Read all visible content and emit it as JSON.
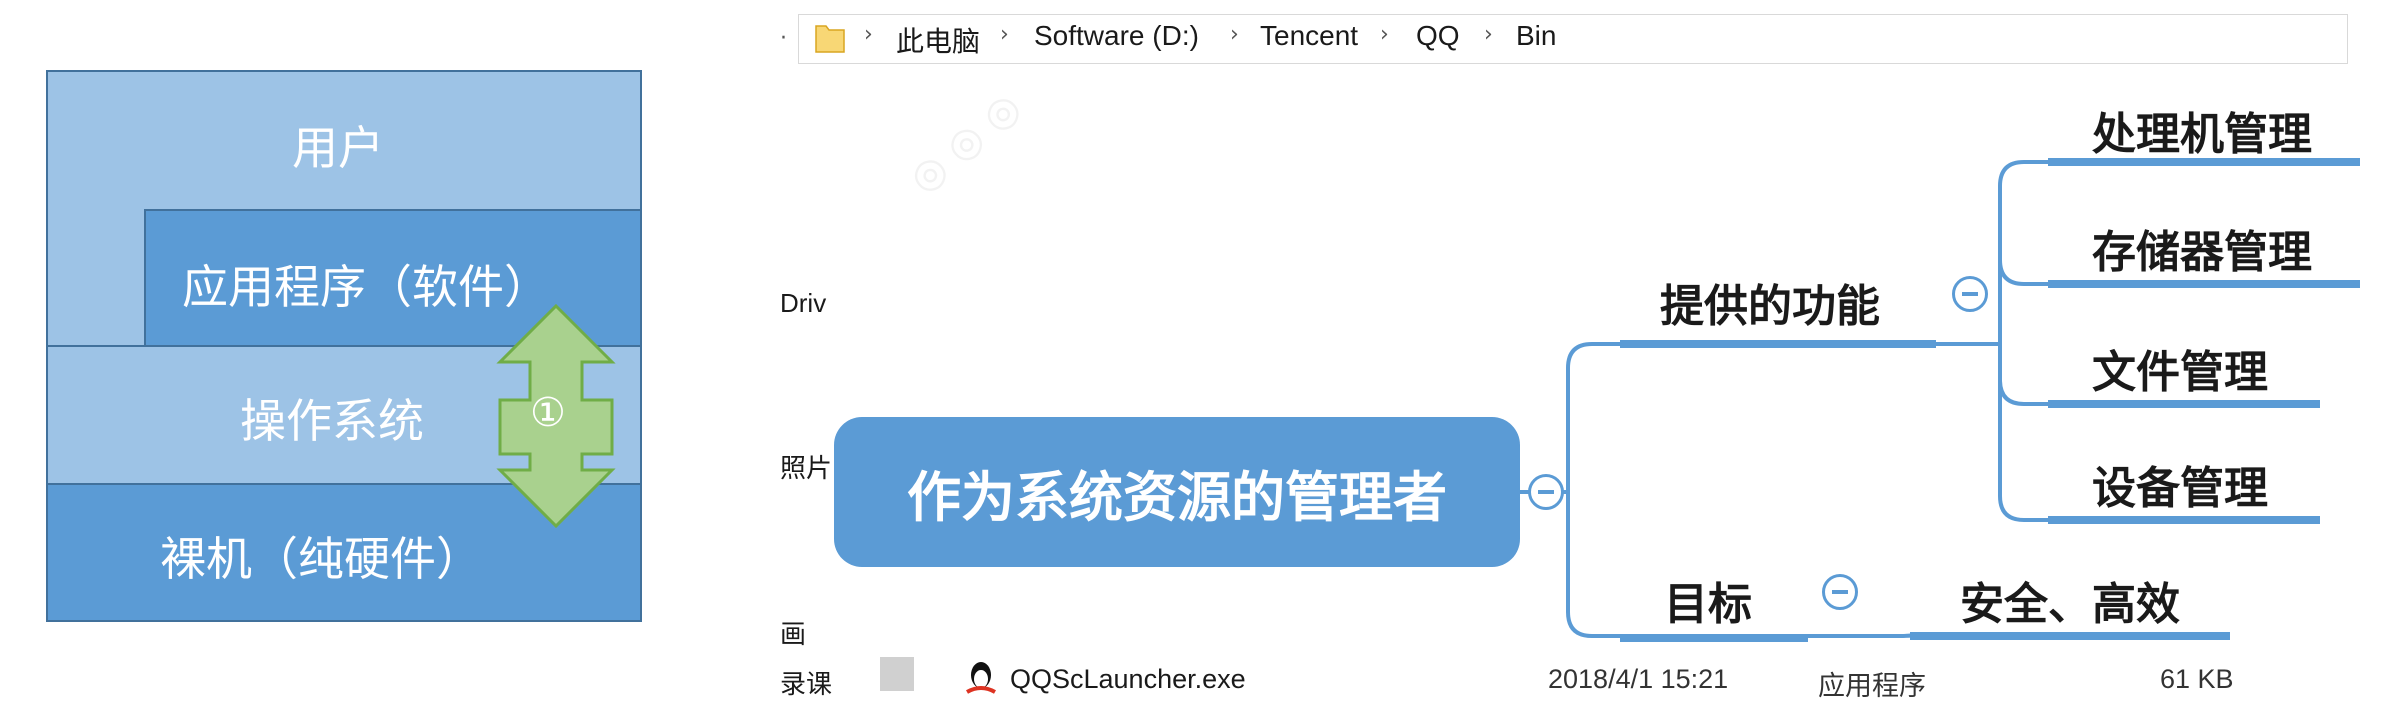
{
  "layers": {
    "user": "用户",
    "app": "应用程序（软件）",
    "os": "操作系统",
    "hardware": "裸机（纯硬件）",
    "marker": "①"
  },
  "explorer": {
    "breadcrumb": [
      "此电脑",
      "Software (D:)",
      "Tencent",
      "QQ",
      "Bin"
    ],
    "sidebar_fragments": [
      "Driv",
      "照片",
      "画",
      "录课"
    ],
    "file": {
      "name": "QQScLauncher.exe",
      "date": "2018/4/1 15:21",
      "type": "应用程序",
      "size": "61 KB"
    }
  },
  "mindmap": {
    "root": "作为系统资源的管理者",
    "branches": [
      {
        "label": "提供的功能",
        "children": [
          "处理机管理",
          "存储器管理",
          "文件管理",
          "设备管理"
        ]
      },
      {
        "label": "目标",
        "children": [
          "安全、高效"
        ]
      }
    ]
  },
  "colors": {
    "dark_blue": "#5b9bd5",
    "light_blue": "#9dc3e6",
    "arrow_green": "#a9d18e"
  }
}
